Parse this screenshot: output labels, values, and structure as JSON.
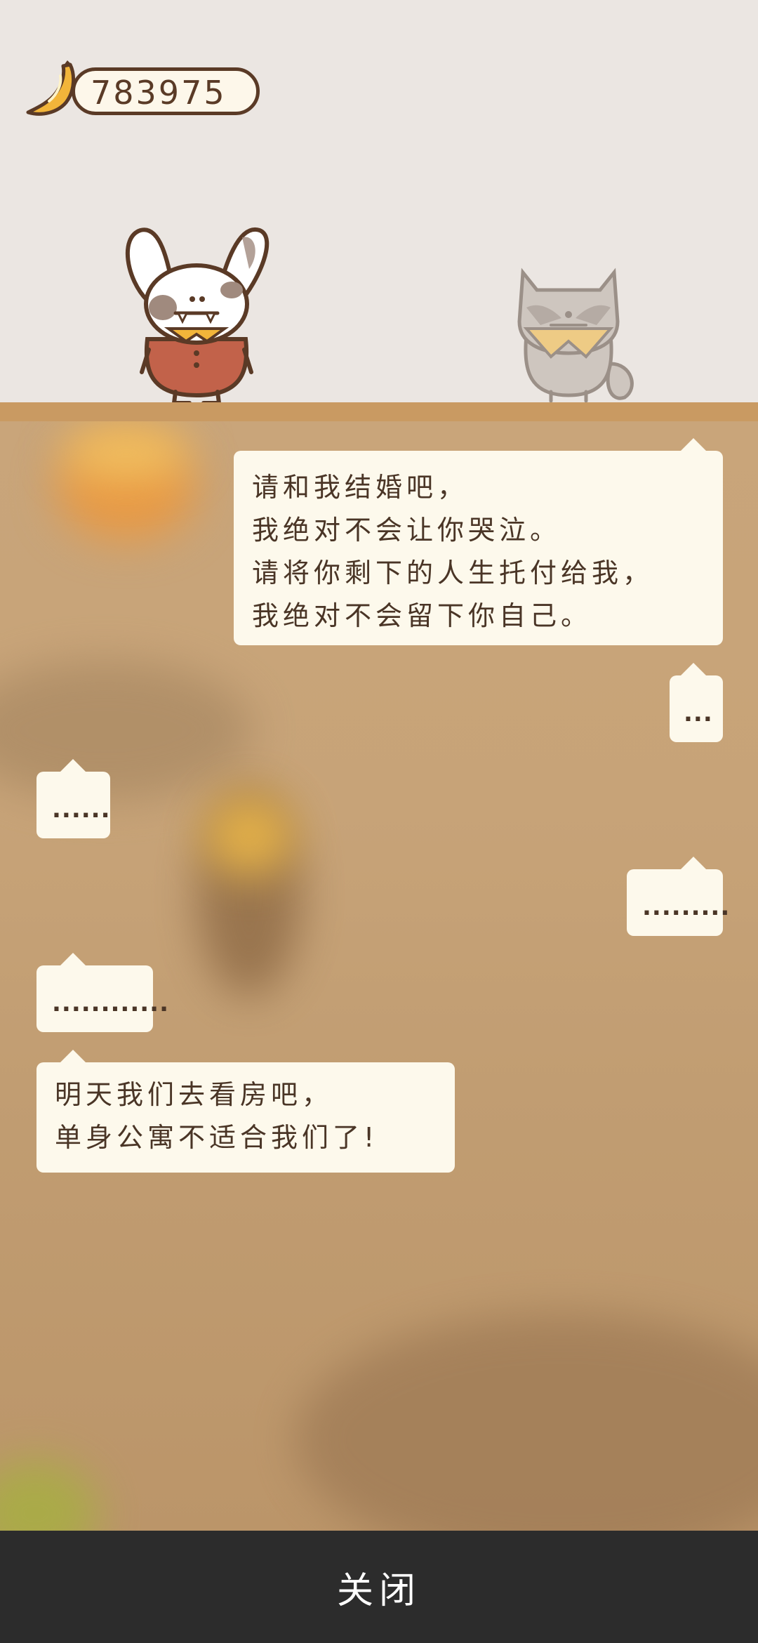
{
  "header": {
    "coin_count": "783975",
    "coin_icon": "banana-icon"
  },
  "dialog": {
    "messages": [
      {
        "side": "right",
        "lines": [
          "请和我结婚吧，",
          "我绝对不会让你哭泣。",
          "请将你剩下的人生托付给我，",
          "我绝对不会留下你自己。"
        ]
      },
      {
        "side": "right",
        "lines": [
          "..."
        ]
      },
      {
        "side": "left",
        "lines": [
          "......"
        ]
      },
      {
        "side": "right",
        "lines": [
          "........."
        ]
      },
      {
        "side": "left",
        "lines": [
          "............"
        ]
      },
      {
        "side": "left",
        "lines": [
          "明天我们去看房吧，",
          "单身公寓不适合我们了!"
        ]
      }
    ]
  },
  "footer": {
    "close_label": "关闭"
  },
  "colors": {
    "background": "#ebe6e2",
    "shelf": "#c99a62",
    "bubble": "#fdf9ec",
    "text": "#4a3526",
    "bar": "#2c2c2c"
  }
}
